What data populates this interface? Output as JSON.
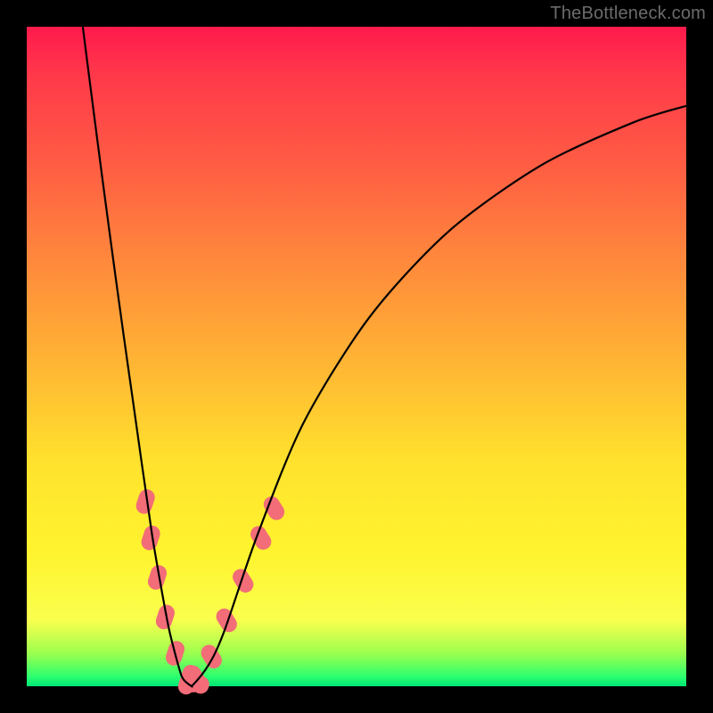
{
  "watermark": "TheBottleneck.com",
  "chart_data": {
    "type": "line",
    "title": "",
    "xlabel": "",
    "ylabel": "",
    "xlim": [
      0,
      1
    ],
    "ylim": [
      0,
      1
    ],
    "curve": {
      "description": "V-shaped asymmetric valley curve; steep descent from top-left to a minimum near x≈0.24, then a shallower ascent toward mid-right.",
      "points": [
        {
          "x": 0.085,
          "y": 1.0
        },
        {
          "x": 0.12,
          "y": 0.72
        },
        {
          "x": 0.16,
          "y": 0.44
        },
        {
          "x": 0.19,
          "y": 0.23
        },
        {
          "x": 0.215,
          "y": 0.09
        },
        {
          "x": 0.235,
          "y": 0.015
        },
        {
          "x": 0.25,
          "y": 0.0
        },
        {
          "x": 0.27,
          "y": 0.015
        },
        {
          "x": 0.3,
          "y": 0.085
        },
        {
          "x": 0.35,
          "y": 0.23
        },
        {
          "x": 0.42,
          "y": 0.4
        },
        {
          "x": 0.52,
          "y": 0.56
        },
        {
          "x": 0.64,
          "y": 0.69
        },
        {
          "x": 0.78,
          "y": 0.79
        },
        {
          "x": 0.92,
          "y": 0.855
        },
        {
          "x": 1.0,
          "y": 0.88
        }
      ]
    },
    "marker_clusters": {
      "color": "#f26d78",
      "description": "Pill/capsule-shaped salmon markers clustered on the lower flanks of the V near the minimum.",
      "left_branch_center_y": [
        0.01,
        0.05,
        0.105,
        0.165,
        0.225,
        0.28
      ],
      "left_branch_x_at_y": [
        0.245,
        0.225,
        0.21,
        0.198,
        0.188,
        0.18
      ],
      "right_branch_center_y": [
        0.01,
        0.045,
        0.1,
        0.16,
        0.225,
        0.27
      ],
      "right_branch_x_at_y": [
        0.258,
        0.28,
        0.303,
        0.328,
        0.355,
        0.375
      ]
    },
    "gradient_stops": [
      {
        "pos": 0.0,
        "color": "#ff1a4d"
      },
      {
        "pos": 0.35,
        "color": "#ff873c"
      },
      {
        "pos": 0.66,
        "color": "#ffe22d"
      },
      {
        "pos": 0.95,
        "color": "#9cff4e"
      },
      {
        "pos": 1.0,
        "color": "#00e676"
      }
    ]
  }
}
